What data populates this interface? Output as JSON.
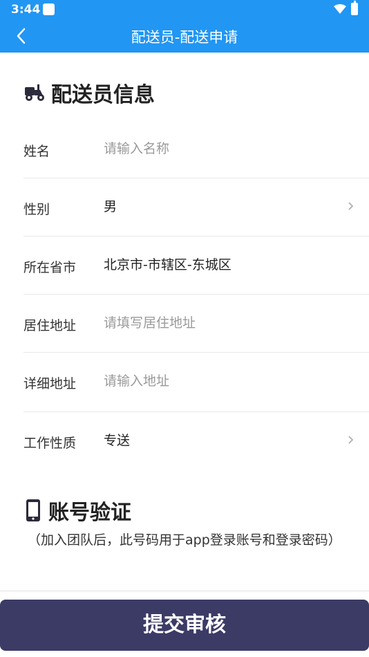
{
  "statusbar": {
    "time": "3:44"
  },
  "appbar": {
    "title": "配送员-配送申请"
  },
  "rider_section": {
    "title": "配送员信息",
    "icon": "scooter-icon"
  },
  "fields": [
    {
      "label": "姓名",
      "value": "",
      "placeholder": "请输入名称",
      "chevron": false
    },
    {
      "label": "性别",
      "value": "男",
      "placeholder": "",
      "chevron": true
    },
    {
      "label": "所在省市",
      "value": "北京市-市辖区-东城区",
      "placeholder": "",
      "chevron": false
    },
    {
      "label": "居住地址",
      "value": "",
      "placeholder": "请填写居住地址",
      "chevron": false
    },
    {
      "label": "详细地址",
      "value": "",
      "placeholder": "请输入地址",
      "chevron": false
    },
    {
      "label": "工作性质",
      "value": "专送",
      "placeholder": "",
      "chevron": true
    }
  ],
  "account_section": {
    "title": "账号验证",
    "icon": "phone-icon",
    "note": "（加入团队后，此号码用于app登录账号和登录密码）"
  },
  "submit": {
    "label": "提交审核"
  },
  "colors": {
    "primary": "#2196f3",
    "button": "#3c3b66"
  }
}
